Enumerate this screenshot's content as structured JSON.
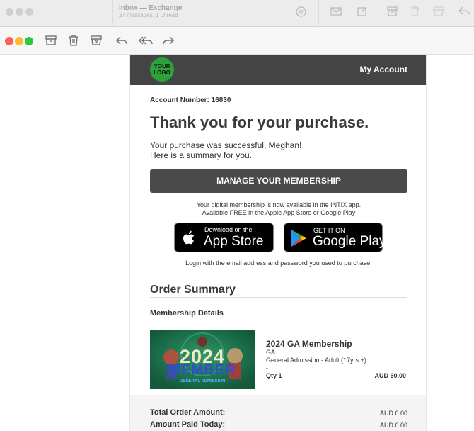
{
  "background_window": {
    "mailbox_title": "Inbox — Exchange",
    "mailbox_subtitle": "27 messages, 1 unread"
  },
  "toolbar": {
    "icons": [
      "archive-icon",
      "trash-icon",
      "junk-icon",
      "reply-icon",
      "reply-all-icon",
      "forward-icon"
    ]
  },
  "email": {
    "header": {
      "logo_text": "YOUR LOGO",
      "logo_color": "#2ba33a",
      "my_account": "My Account"
    },
    "account_number": "Account Number: 16830",
    "heading": "Thank you for your purchase.",
    "message_line1": "Your purchase was successful, Meghan!",
    "message_line2": "Here is a summary for you.",
    "manage_button": "MANAGE YOUR MEMBERSHIP",
    "app_note_line1": "Your digital membership is now available in the INTIX app.",
    "app_note_line2": "Available FREE in the Apple App Store or Google Play",
    "app_store": {
      "small": "Download on the",
      "big": "App Store"
    },
    "google_play": {
      "small": "GET IT ON",
      "big": "Google Play"
    },
    "login_note": "Login with the email address and password you used to purchase.",
    "order_summary_heading": "Order Summary",
    "membership_details_heading": "Membership Details",
    "item": {
      "image_year": "2024",
      "image_word": "MEMBER",
      "image_caption": "GENERAL ADMISSION",
      "title": "2024 GA Membership",
      "line1": "GA",
      "line2": "General Admission - Adult (17yrs +)",
      "line3": "-",
      "qty": "Qty 1",
      "price": "AUD 60.00"
    },
    "totals": {
      "total_label": "Total Order Amount:",
      "total_value": "AUD 0.00",
      "paid_label": "Amount Paid Today:",
      "paid_value": "AUD 0.00"
    }
  }
}
